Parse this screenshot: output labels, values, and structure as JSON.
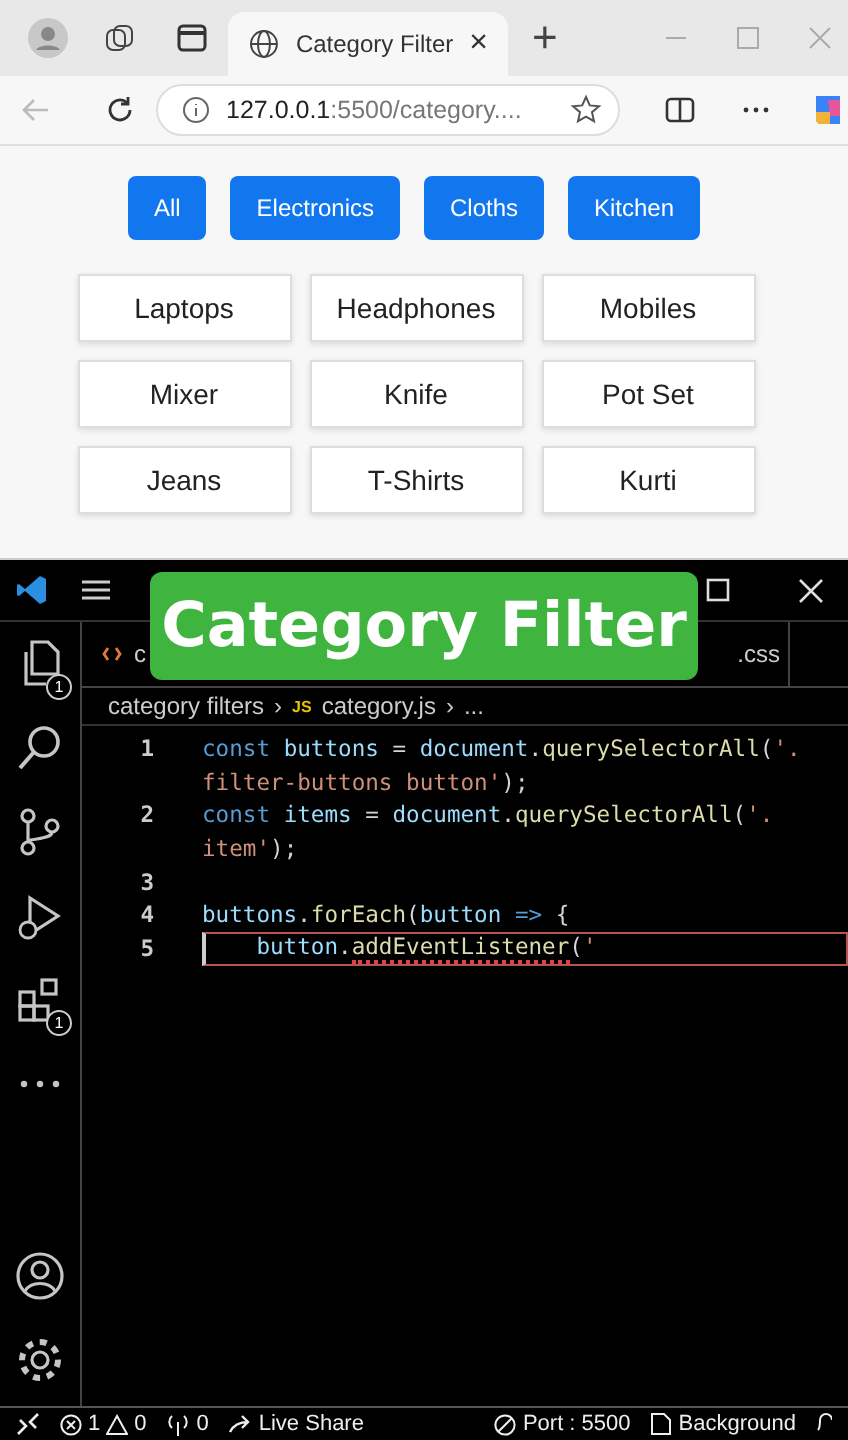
{
  "browser": {
    "tab": {
      "title": "Category Filter",
      "close": "×"
    },
    "new_tab": "+",
    "address": {
      "host": "127.0.0.1",
      "rest": ":5500/category...."
    }
  },
  "page": {
    "filters": [
      "All",
      "Electronics",
      "Cloths",
      "Kitchen"
    ],
    "items": [
      "Laptops",
      "Headphones",
      "Mobiles",
      "Mixer",
      "Knife",
      "Pot Set",
      "Jeans",
      "T-Shirts",
      "Kurti"
    ]
  },
  "editor": {
    "overlay_title": "Category Filter",
    "tabs": [
      {
        "label": "c",
        "kind": "html"
      },
      {
        "label": ".css",
        "kind": "css"
      }
    ],
    "breadcrumb": {
      "folder": "category filters",
      "separator": "›",
      "file_icon": "JS",
      "file": "category.js",
      "rest": "..."
    },
    "lines": [
      {
        "number": "1",
        "active": false,
        "tokens": [
          {
            "kind": "keyword",
            "text": "const "
          },
          {
            "kind": "variable",
            "text": "buttons"
          },
          {
            "kind": "plain",
            "text": " = "
          },
          {
            "kind": "variable",
            "text": "document"
          },
          {
            "kind": "plain",
            "text": "."
          },
          {
            "kind": "function",
            "text": "querySelectorAll"
          },
          {
            "kind": "plain",
            "text": "("
          },
          {
            "kind": "string",
            "text": "'."
          }
        ]
      },
      {
        "active": false,
        "tokens": [
          {
            "kind": "string",
            "text": "filter-buttons button'"
          },
          {
            "kind": "plain",
            "text": ");"
          }
        ]
      },
      {
        "number": "2",
        "active": false,
        "tokens": [
          {
            "kind": "keyword",
            "text": "const "
          },
          {
            "kind": "variable",
            "text": "items"
          },
          {
            "kind": "plain",
            "text": " = "
          },
          {
            "kind": "variable",
            "text": "document"
          },
          {
            "kind": "plain",
            "text": "."
          },
          {
            "kind": "function",
            "text": "querySelectorAll"
          },
          {
            "kind": "plain",
            "text": "("
          },
          {
            "kind": "string",
            "text": "'."
          }
        ]
      },
      {
        "active": false,
        "tokens": [
          {
            "kind": "string",
            "text": "item'"
          },
          {
            "kind": "plain",
            "text": ");"
          }
        ]
      },
      {
        "number": "3",
        "active": false
      },
      {
        "number": "4",
        "active": false,
        "tokens": [
          {
            "kind": "variable",
            "text": "buttons"
          },
          {
            "kind": "plain",
            "text": "."
          },
          {
            "kind": "function",
            "text": "forEach"
          },
          {
            "kind": "plain",
            "text": "("
          },
          {
            "kind": "variable",
            "text": "button"
          },
          {
            "kind": "keyword",
            "text": " => "
          },
          {
            "kind": "plain",
            "text": "{"
          }
        ]
      },
      {
        "number": "5",
        "active": true,
        "tokens": [
          {
            "kind": "variable",
            "text": "    button"
          },
          {
            "kind": "plain",
            "text": "."
          },
          {
            "kind": "function",
            "text": "addEventListener",
            "error": true
          },
          {
            "kind": "plain",
            "text": "("
          },
          {
            "kind": "string",
            "text": "'"
          }
        ]
      }
    ],
    "badges": {
      "explorer": "1",
      "extensions": "1"
    },
    "status_bar": {
      "errors": "1",
      "warnings": "0",
      "ports_count": "0",
      "live_share": "Live Share",
      "port": "Port : 5500",
      "background": "Background"
    }
  }
}
